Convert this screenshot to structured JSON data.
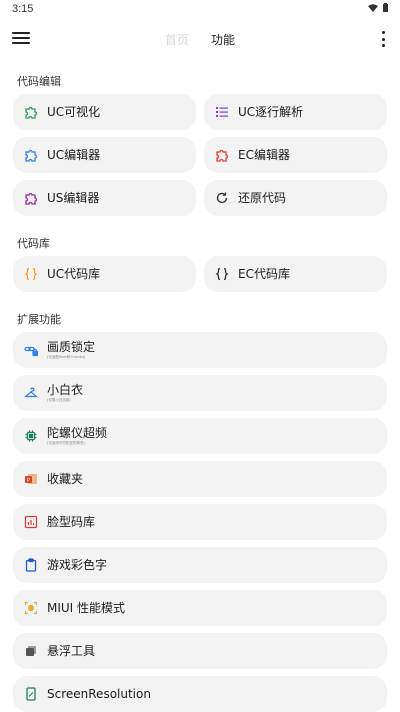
{
  "status": {
    "time": "3:15"
  },
  "tabs": {
    "home": "首页",
    "features": "功能"
  },
  "sections": {
    "code_edit": "代码编辑",
    "code_library": "代码库",
    "extended": "扩展功能"
  },
  "code_edit_items": {
    "uc_visual": "UC可视化",
    "uc_line_parse": "UC逐行解析",
    "uc_editor": "UC编辑器",
    "ec_editor": "EC编辑器",
    "us_editor": "US编辑器",
    "restore_code": "还原代码"
  },
  "code_library_items": {
    "uc_library": "UC代码库",
    "ec_library": "EC代码库"
  },
  "extended_items": {
    "quality_lock": {
      "label": "画质锁定",
      "sub": "(仅适配Root和Shizuku)"
    },
    "white_coat": {
      "label": "小白衣",
      "sub": "(仅限小白衣用)"
    },
    "gyro_overclock": {
      "label": "陀螺仪超频",
      "sub": "(仅适用不同机型的情况)"
    },
    "favorites": "收藏夹",
    "face_code_library": "脸型码库",
    "game_color_text": "游戏彩色字",
    "miui_performance": "MIUI 性能模式",
    "float_tool": "悬浮工具",
    "screen_resolution": "ScreenResolution"
  },
  "colors": {
    "accent_green": "#2e9e5b",
    "accent_purple": "#7b3fe4",
    "accent_blue": "#2f80ed",
    "accent_red": "#e53935",
    "accent_magenta": "#9c27b0",
    "accent_orange": "#f5a623",
    "card_bg": "#f3f3f3"
  }
}
